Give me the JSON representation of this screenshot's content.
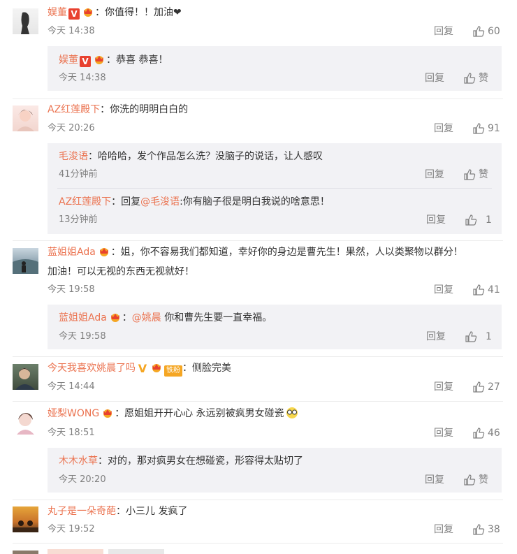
{
  "comments": [
    {
      "author": "娱董",
      "badge_v": "V",
      "text": "：你值得！！加油",
      "heart": "❤",
      "time": "今天 14:38",
      "reply": "回复",
      "likes": "60",
      "replies": [
        {
          "author": "娱董",
          "badge_v": "V",
          "text": "：恭喜 恭喜！",
          "time": "今天 14:38",
          "reply": "回复",
          "likes": "赞"
        }
      ]
    },
    {
      "author": "AZ红莲殿下",
      "text": "：你洗的明明白白的",
      "time": "今天 20:26",
      "reply": "回复",
      "likes": "91",
      "replies": [
        {
          "author": "毛浚语",
          "text": "：哈哈哈，发个作品怎么洗？没脑子的说话，让人感叹",
          "time": "41分钟前",
          "reply": "回复",
          "likes": "赞"
        },
        {
          "author": "AZ红莲殿下",
          "text_pre": "：回复",
          "mention": "@毛浚语",
          "text": ":你有脑子很是明白我说的啥意思！",
          "time": "13分钟前",
          "reply": "回复",
          "likes": "1"
        }
      ]
    },
    {
      "author": "蓝姐姐Ada",
      "text": "：姐，你不容易我们都知道，幸好你的身边是曹先生！果然，人以类聚物以群分！",
      "text2": "加油！可以无视的东西无视就好！",
      "time": "今天 19:58",
      "reply": "回复",
      "likes": "41",
      "replies": [
        {
          "author": "蓝姐姐Ada",
          "text_pre": "：",
          "mention": "@姚晨",
          "text": " 你和曹先生要一直幸福。",
          "time": "今天 19:58",
          "reply": "回复",
          "likes": "1"
        }
      ]
    },
    {
      "author": "今天我喜欢姚晨了吗",
      "badge_v": "V",
      "fan_label": "铁粉",
      "text": "：侧脸完美",
      "time": "今天 14:44",
      "reply": "回复",
      "likes": "27"
    },
    {
      "author": "娅梨WONG",
      "text": "：愿姐姐开开心心 永远别被疯男女碰瓷",
      "time": "今天 18:51",
      "reply": "回复",
      "likes": "46",
      "replies": [
        {
          "author": "木木水草",
          "text": "：对的，那对疯男女在想碰瓷，形容得太贴切了",
          "time": "今天 20:20",
          "reply": "回复",
          "likes": "赞"
        }
      ]
    },
    {
      "author": "丸子是一朵奇葩",
      "text": "：小三儿 发疯了",
      "time": "今天 19:52",
      "reply": "回复",
      "likes": "38"
    }
  ],
  "colors": {
    "name": "#eb7350",
    "meta": "#808080",
    "subbox": "#f2f2f5"
  }
}
